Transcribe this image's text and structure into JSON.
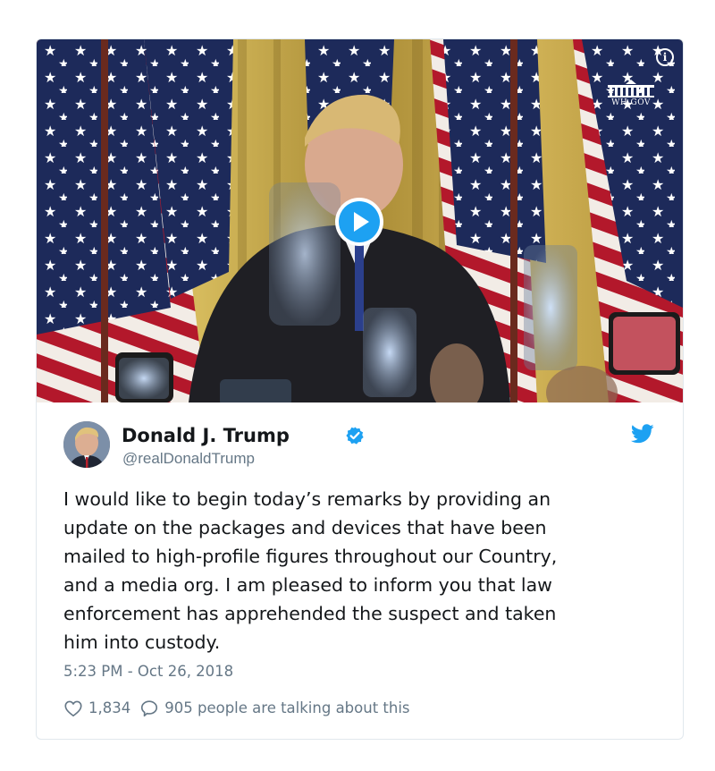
{
  "media": {
    "source_label": "WH.GOV",
    "info_icon": "info-icon",
    "play_icon": "play-icon"
  },
  "tweet": {
    "author_name": "Donald J. Trump",
    "handle": "@realDonaldTrump",
    "verified_icon": "verified-badge-icon",
    "brand_icon": "twitter-bird-icon",
    "text_lines": [
      "I would like to begin today’s remarks by providing an",
      "update on the packages and devices that have been",
      "mailed to high-profile figures throughout our Country,",
      "and a media org. I am pleased to inform you that law",
      "enforcement has apprehended the suspect and taken",
      "him into custody."
    ],
    "timestamp": "5:23 PM - Oct 26, 2018",
    "likes": "1,834",
    "talking": "905 people are talking about this"
  },
  "colors": {
    "twitter_blue": "#1da1f2",
    "secondary_text": "#657786",
    "primary_text": "#14171a",
    "border": "#e1e8ed"
  }
}
